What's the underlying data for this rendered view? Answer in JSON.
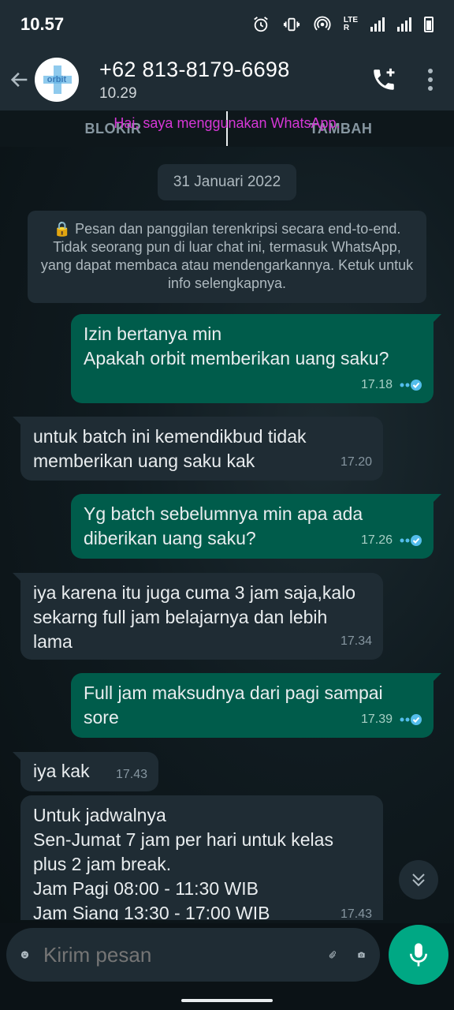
{
  "status_bar": {
    "time": "10.57"
  },
  "header": {
    "contact_name": "+62 813-8179-6698",
    "subtitle": "10.29",
    "avatar_text": "orbit"
  },
  "action_bar": {
    "block_label": "BLOKIR",
    "add_label": "TAMBAH",
    "about_text": "Hai, saya menggunakan WhatsApp."
  },
  "date_chip": "31 Januari 2022",
  "encryption_notice": "Pesan dan panggilan terenkripsi secara end-to-end. Tidak seorang pun di luar chat ini, termasuk WhatsApp, yang dapat membaca atau mendengarkannya. Ketuk untuk info selengkapnya.",
  "messages": [
    {
      "text": "Izin bertanya min\nApakah orbit memberikan uang saku?",
      "time": "17.18"
    },
    {
      "text": "untuk batch ini kemendikbud tidak memberikan uang saku kak",
      "time": "17.20"
    },
    {
      "text": "Yg batch sebelumnya min apa ada diberikan uang saku?",
      "time": "17.26"
    },
    {
      "text": "iya karena itu juga cuma 3 jam saja,kalo sekarng full jam belajarnya dan lebih lama",
      "time": "17.34"
    },
    {
      "text": "Full jam maksudnya dari pagi sampai sore",
      "time": "17.39"
    },
    {
      "text": "iya kak",
      "time": "17.43"
    },
    {
      "text": "Untuk jadwalnya\nSen-Jumat 7 jam per hari untuk kelas plus 2 jam break.\nJam Pagi   08:00 - 11:30 WIB\nJam Siang 13:30 - 17:00 WIB",
      "time": "17.43"
    }
  ],
  "input": {
    "placeholder": "Kirim pesan"
  },
  "colors": {
    "outgoing": "#005c4b",
    "incoming": "#1f2c34",
    "accent": "#00a884",
    "read_tick": "#53bdeb"
  }
}
